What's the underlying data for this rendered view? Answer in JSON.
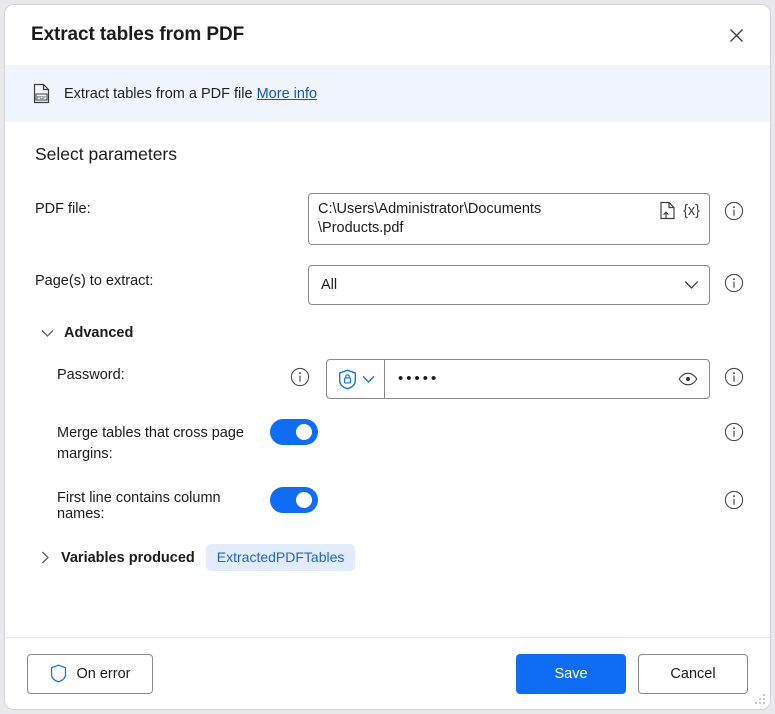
{
  "window": {
    "title": "Extract tables from PDF",
    "close_label": "✕"
  },
  "banner": {
    "icon": "pdf-file-icon",
    "text": "Extract tables from a PDF file",
    "link_label": "More info"
  },
  "main": {
    "section_title": "Select parameters",
    "pdf_file": {
      "label": "PDF file:",
      "value": "C:\\Users\\Administrator\\Documents\n\\Products.pdf",
      "file_icon": "file-upload-icon",
      "variable_icon": "{x}",
      "info_icon": "info-icon"
    },
    "pages": {
      "label": "Page(s) to extract:",
      "value": "All",
      "chevron_icon": "chevron-down-icon",
      "info_icon": "info-icon"
    },
    "advanced": {
      "label": "Advanced",
      "expanded": true,
      "chevron_icon": "chevron-down-icon",
      "password": {
        "label": "Password:",
        "value": "•••••",
        "mode_icon": "shield-lock-icon",
        "mode_chevron_icon": "chevron-down-icon",
        "reveal_icon": "eye-icon",
        "info_icon": "info-icon"
      },
      "merge_tables": {
        "label": "Merge tables that cross page margins:",
        "enabled": true,
        "info_icon": "info-icon"
      },
      "first_line_columns": {
        "label": "First line contains column names:",
        "enabled": true,
        "info_icon": "info-icon"
      }
    },
    "variables_produced": {
      "label": "Variables produced",
      "expanded": false,
      "chevron_icon": "chevron-right-icon",
      "variables": [
        "ExtractedPDFTables"
      ]
    }
  },
  "footer": {
    "on_error_label": "On error",
    "on_error_icon": "shield-icon",
    "save_label": "Save",
    "cancel_label": "Cancel"
  },
  "colors": {
    "accent": "#0f6cf5",
    "link": "#0f55c7",
    "banner_bg": "#f0f5fd",
    "pill_bg": "#e3ecfc",
    "pill_text": "#1867dd"
  }
}
